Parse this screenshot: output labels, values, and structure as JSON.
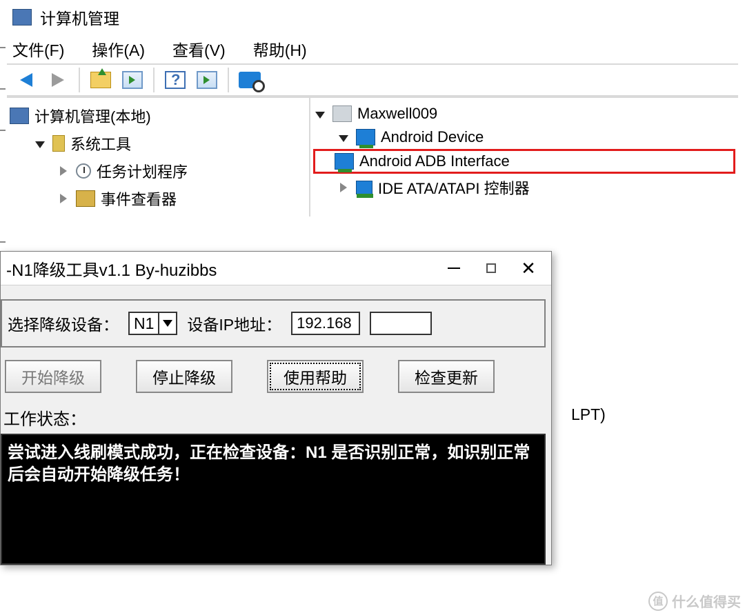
{
  "cm": {
    "window_title": "计算机管理",
    "menu": {
      "file": "文件(F)",
      "action": "操作(A)",
      "view": "查看(V)",
      "help": "帮助(H)"
    },
    "left_tree": {
      "root": "计算机管理(本地)",
      "sys_tools": "系统工具",
      "task_scheduler": "任务计划程序",
      "event_viewer": "事件查看器"
    },
    "right_tree": {
      "root": "Maxwell009",
      "android_device": "Android Device",
      "adb_interface": "Android ADB Interface",
      "ide": "IDE ATA/ATAPI 控制器",
      "ports_partial": "LPT)"
    }
  },
  "dialog": {
    "title": "-N1降级工具v1.1 By-huzibbs",
    "select_device_label": "选择降级设备：",
    "device_selected": "N1",
    "ip_label": "设备IP地址：",
    "ip_value": "192.168",
    "buttons": {
      "start": "开始降级",
      "stop": "停止降级",
      "help": "使用帮助",
      "check_update": "检查更新"
    },
    "status_label": "工作状态：",
    "console_text": "尝试进入线刷模式成功，正在检查设备：N1 是否识别正常，如识别正常后会自动开始降级任务！"
  },
  "watermark": {
    "badge": "值",
    "text": "什么值得买"
  }
}
